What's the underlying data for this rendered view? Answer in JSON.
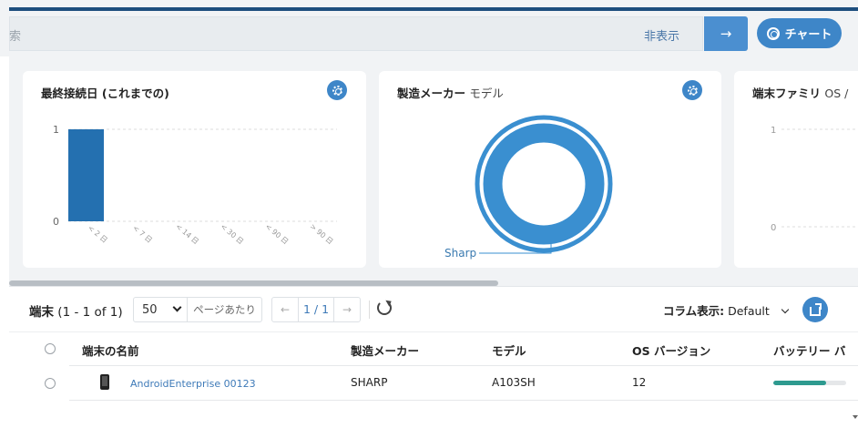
{
  "search": {
    "text": "索",
    "hide_label": "非表示",
    "go_arrow": "→",
    "chart_button": "チャート"
  },
  "cards": [
    {
      "title": "最終接続日 (これまでの)",
      "chart_data": {
        "type": "bar",
        "categories": [
          "< 2 日",
          "< 7 日",
          "< 14 日",
          "< 30 日",
          "< 90 日",
          "> 90 日"
        ],
        "values": [
          1,
          0,
          0,
          0,
          0,
          0
        ],
        "yticks": [
          "0",
          "1"
        ],
        "ylim": [
          0,
          1
        ],
        "grid": true,
        "colors": {
          "bar": "#2470b0"
        }
      }
    },
    {
      "title_bold": "製造メーカー",
      "title_light": "モデル",
      "chart_data": {
        "type": "pie",
        "slices": [
          {
            "name": "Sharp",
            "value": 1
          }
        ],
        "colors": {
          "ring": "#3a8fd0"
        }
      }
    },
    {
      "title_bold": "端末ファミリ",
      "title_light": "OS /",
      "chart_data": {
        "type": "bar",
        "yticks": [
          "0",
          "1"
        ],
        "ylim": [
          0,
          1
        ],
        "grid": true
      }
    }
  ],
  "list": {
    "devices_label": "端末",
    "devices_count": "(1 - 1 of 1)",
    "per_page_value": "50",
    "per_page_label": "ページあたり",
    "pager_prev": "←",
    "pager_page": "1 / 1",
    "pager_next": "→",
    "column_display_label": "コラム表示:",
    "column_display_value": "Default"
  },
  "table": {
    "columns": [
      "端末の名前",
      "製造メーカー",
      "モデル",
      "OS バージョン",
      "バッテリー バ"
    ],
    "rows": [
      {
        "name": "AndroidEnterprise 00123",
        "manufacturer": "SHARP",
        "model": "A103SH",
        "os": "12",
        "battery_level": 0.72
      }
    ]
  },
  "colors": {
    "accent": "#3e86c8",
    "battery": "#2e9a8f"
  }
}
